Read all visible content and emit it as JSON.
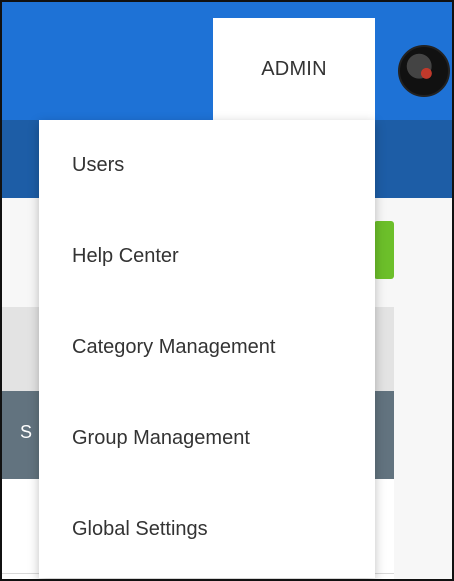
{
  "header": {
    "admin_label": "ADMIN"
  },
  "background": {
    "strip_letter": "S"
  },
  "admin_menu": {
    "items": [
      {
        "label": "Users"
      },
      {
        "label": "Help Center"
      },
      {
        "label": "Category Management"
      },
      {
        "label": "Group Management"
      },
      {
        "label": "Global Settings"
      }
    ]
  },
  "colors": {
    "top_bar": "#1e72d6",
    "nav_bar": "#1d5da6",
    "green_button": "#6cbf2a",
    "table_header": "#62737f"
  }
}
